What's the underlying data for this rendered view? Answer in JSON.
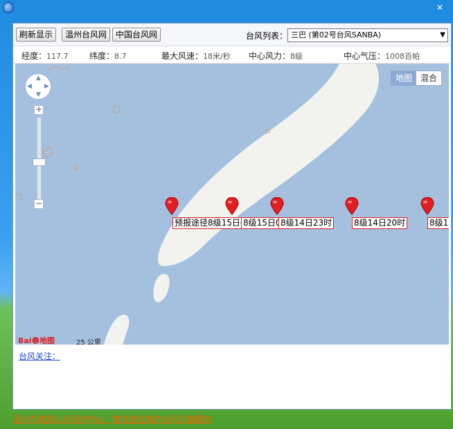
{
  "toolbar": {
    "refresh_label": "刷新显示",
    "wenzhou_label": "温州台风网",
    "china_label": "中国台风网",
    "typhoon_list_label": "台风列表：",
    "typhoon_selected": "三巴 (第02号台风SANBA)"
  },
  "info": {
    "lon_label": "经度：",
    "lon": "117.7",
    "lat_label": "纬度：",
    "lat": "8.7",
    "wind_label": "最大风速：",
    "wind": "18米/秒",
    "force_label": "中心风力：",
    "force": "8级",
    "pressure_label": "中心气压：",
    "pressure": "1008百帕"
  },
  "map": {
    "type_map": "地图",
    "type_hybrid": "混合",
    "scale": "25 公里",
    "colors": {
      "sea": "#a5c0df",
      "land": "#f2f2ef",
      "marker": "#e02020"
    },
    "markers": [
      {
        "label": "预报途径8级15日05时"
      },
      {
        "label": "8级15日02时"
      },
      {
        "label": "8级14日23时"
      },
      {
        "label": "8级14日20时"
      },
      {
        "label": "8级1"
      }
    ]
  },
  "attention_link": "台风关注：",
  "footer_link": "温州市政府公共服务中心：推出更优质的台风防御服务"
}
